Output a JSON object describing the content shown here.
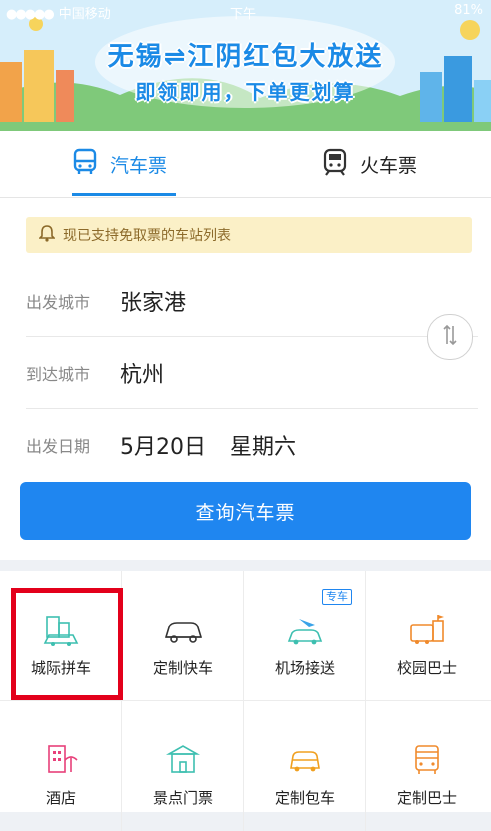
{
  "status_bar": {
    "carrier": "中国移动",
    "time": "下午",
    "battery": "81%"
  },
  "banner": {
    "title": "无锡⇌江阴红包大放送",
    "subtitle": "即领即用，下单更划算"
  },
  "tabs": [
    {
      "label": "汽车票",
      "active": true,
      "icon": "bus-icon"
    },
    {
      "label": "火车票",
      "active": false,
      "icon": "train-icon"
    }
  ],
  "notice": {
    "text": "现已支持免取票的车站列表",
    "icon": "bell-icon"
  },
  "form": {
    "departure": {
      "label": "出发城市",
      "value": "张家港"
    },
    "arrival": {
      "label": "到达城市",
      "value": "杭州"
    },
    "date": {
      "label": "出发日期",
      "value": "5月20日",
      "weekday": "星期六"
    }
  },
  "search_button": "查询汽车票",
  "services": [
    {
      "label": "城际拼车",
      "icon": "carpool-icon",
      "tag": ""
    },
    {
      "label": "定制快车",
      "icon": "custom-car-icon",
      "tag": ""
    },
    {
      "label": "机场接送",
      "icon": "airport-transfer-icon",
      "tag": "专车"
    },
    {
      "label": "校园巴士",
      "icon": "campus-bus-icon",
      "tag": ""
    },
    {
      "label": "酒店",
      "icon": "hotel-icon",
      "tag": ""
    },
    {
      "label": "景点门票",
      "icon": "attraction-ticket-icon",
      "tag": ""
    },
    {
      "label": "定制包车",
      "icon": "charter-car-icon",
      "tag": ""
    },
    {
      "label": "定制巴士",
      "icon": "custom-bus-icon",
      "tag": ""
    }
  ],
  "colors": {
    "accent": "#1f86f0",
    "notice_bg": "#fbf0c7",
    "highlight": "#e3001b"
  }
}
